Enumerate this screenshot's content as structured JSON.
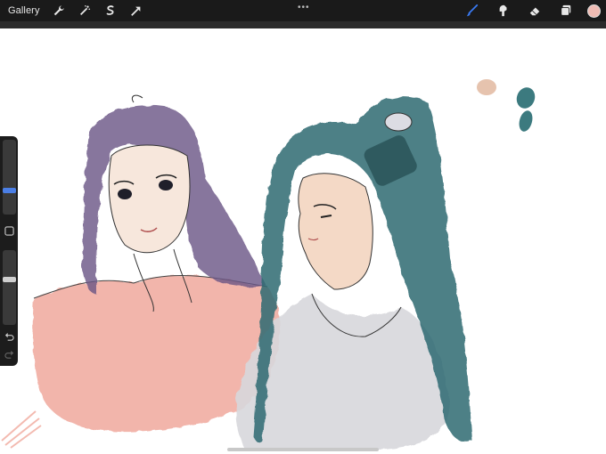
{
  "toolbar": {
    "gallery_label": "Gallery",
    "left_icons": [
      "wrench-icon",
      "magic-wand-icon",
      "selection-icon",
      "transform-icon"
    ],
    "more_glyph": "•••",
    "right_icons": [
      "brush-icon",
      "smudge-icon",
      "eraser-icon",
      "layers-icon"
    ],
    "active_tool": "brush",
    "active_color": "#f0bcb4",
    "accent_color": "#3a7bf5"
  },
  "sidebar": {
    "controls": [
      "brush-size-slider",
      "modify-button",
      "opacity-slider",
      "undo-button",
      "redo-button"
    ]
  },
  "canvas": {
    "palette_swatches": [
      "#e6c3ae",
      "#3c7a7f",
      "#3c7a7f"
    ]
  }
}
